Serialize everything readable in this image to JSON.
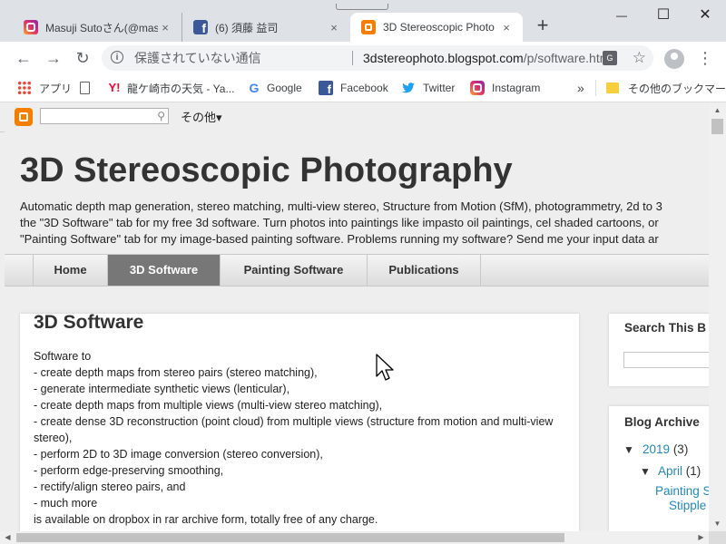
{
  "browser": {
    "tabs": [
      {
        "title": "Masuji Sutoさん(@masu",
        "icon": "instagram-icon",
        "close": "×"
      },
      {
        "title": "(6) 須藤 益司",
        "icon": "facebook-icon",
        "close": "×"
      },
      {
        "title": "3D Stereoscopic Photo",
        "icon": "blogger-icon",
        "close": "×",
        "active": true
      }
    ],
    "new_tab": "+",
    "window_controls": {
      "minimize": "—",
      "maximize": "☐",
      "close": "✕"
    },
    "address": {
      "security_text": "保護されていない通信",
      "url_host": "3dstereophoto.blogspot.com",
      "url_path": "/p/software.html"
    },
    "bookmarks": [
      {
        "label": "アプリ",
        "icon": "apps-grid-icon"
      },
      {
        "label": "",
        "icon": "blank-page-icon"
      },
      {
        "label": "龍ケ崎市の天気 - Ya...",
        "icon": "yahoo-icon"
      },
      {
        "label": "Google",
        "icon": "google-icon"
      },
      {
        "label": "Facebook",
        "icon": "facebook-icon"
      },
      {
        "label": "Twitter",
        "icon": "twitter-icon"
      },
      {
        "label": "Instagram",
        "icon": "instagram-icon"
      }
    ],
    "bookmarks_overflow": "»",
    "other_bookmarks": "その他のブックマーク"
  },
  "blogger_bar": {
    "more_label": "その他▾"
  },
  "blog": {
    "title": "3D Stereoscopic Photography",
    "description": [
      "Automatic depth map generation, stereo matching, multi-view stereo, Structure from Motion (SfM), photogrammetry, 2d to 3",
      "the \"3D Software\" tab for my free 3d software. Turn photos into paintings like impasto oil paintings, cel shaded cartoons, or",
      "\"Painting Software\" tab for my image-based painting software. Problems running my software? Send me your input data ar"
    ],
    "tabs": [
      "Home",
      "3D Software",
      "Painting Software",
      "Publications"
    ],
    "active_tab": "3D Software"
  },
  "post": {
    "title": "3D Software",
    "lines": [
      "Software to",
      "- create depth maps from stereo pairs (stereo matching),",
      "- generate intermediate synthetic views (lenticular),",
      "- create depth maps from multiple views (multi-view stereo matching),",
      "- create dense 3D reconstruction (point cloud) from multiple views (structure from motion and multi-view stereo),",
      "- perform 2D to 3D image conversion (stereo conversion),",
      "- perform edge-preserving smoothing,",
      "- rectify/align stereo pairs, and",
      "- much more",
      "is available on dropbox in rar archive form, totally free of any charge."
    ]
  },
  "sidebar": {
    "search_title": "Search This B",
    "archive_title": "Blog Archive",
    "archive": {
      "year": "2019",
      "year_count": "(3)",
      "month": "April",
      "month_count": "(1)",
      "post_line1": "Painting S",
      "post_line2": "Stipple"
    }
  }
}
